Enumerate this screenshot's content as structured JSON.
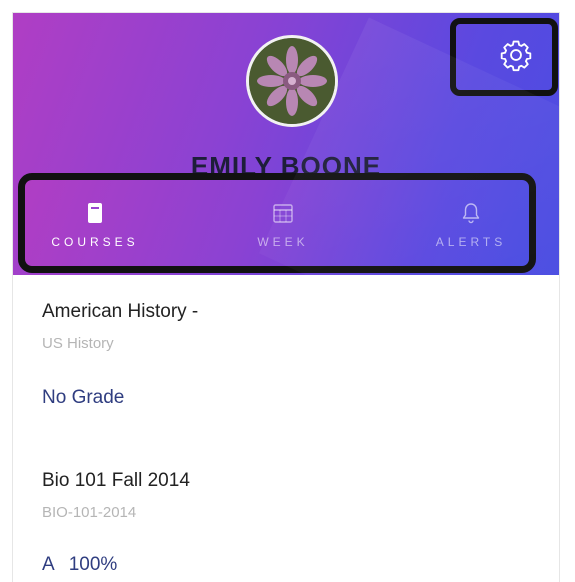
{
  "profile": {
    "name": "EMILY BOONE"
  },
  "icons": {
    "settings": "gear-icon",
    "courses": "book-icon",
    "week": "calendar-icon",
    "alerts": "bell-icon"
  },
  "colors": {
    "header_start": "#b03ec4",
    "header_end": "#4a4de2",
    "grade_text": "#2f3d80",
    "highlight_outline": "#111111"
  },
  "tabs": [
    {
      "label": "COURSES",
      "active": true
    },
    {
      "label": "WEEK",
      "active": false
    },
    {
      "label": "ALERTS",
      "active": false
    }
  ],
  "courses": [
    {
      "title": "American History -",
      "code": "US History",
      "grade": "No Grade"
    },
    {
      "title": "Bio 101 Fall 2014",
      "code": "BIO-101-2014",
      "grade_letter": "A",
      "grade_percent": "100%"
    }
  ]
}
